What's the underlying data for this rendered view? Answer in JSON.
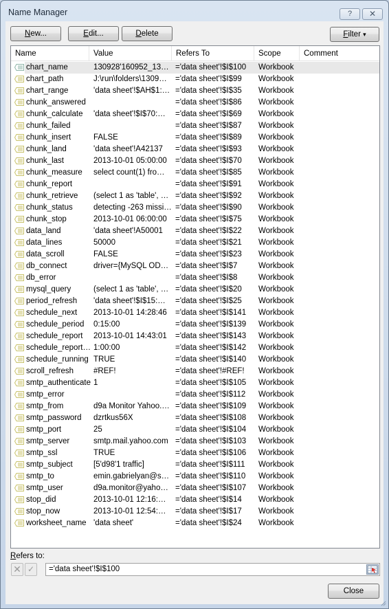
{
  "window": {
    "title": "Name Manager",
    "help_label": "?",
    "close_label": "✕"
  },
  "toolbar": {
    "new": {
      "underline": "N",
      "rest": "ew..."
    },
    "edit": {
      "underline": "E",
      "rest": "dit..."
    },
    "delete": {
      "underline": "D",
      "rest": "elete"
    },
    "filter": {
      "underline": "F",
      "rest": "ilter",
      "arrow": "▾"
    }
  },
  "list": {
    "columns": [
      "Name",
      "Value",
      "Refers To",
      "Scope",
      "Comment"
    ],
    "selected_index": 0,
    "colors": {
      "icon_selected": "#8fb5a8",
      "icon_normal": "#c8c26a",
      "selected_row": "#e8e8e8"
    },
    "rows": [
      {
        "name": "chart_name",
        "value": "130928'160952_13…",
        "refers_to": "='data sheet'!$I$100",
        "scope": "Workbook",
        "comment": ""
      },
      {
        "name": "chart_path",
        "value": "J:\\run\\folders\\1309…",
        "refers_to": "='data sheet'!$I$99",
        "scope": "Workbook",
        "comment": ""
      },
      {
        "name": "chart_range",
        "value": "'data sheet'!$AH$1:…",
        "refers_to": "='data sheet'!$I$35",
        "scope": "Workbook",
        "comment": ""
      },
      {
        "name": "chunk_answered",
        "value": "",
        "refers_to": "='data sheet'!$I$86",
        "scope": "Workbook",
        "comment": ""
      },
      {
        "name": "chunk_calculate",
        "value": "'data sheet'!$I$70:…",
        "refers_to": "='data sheet'!$I$69",
        "scope": "Workbook",
        "comment": ""
      },
      {
        "name": "chunk_failed",
        "value": "",
        "refers_to": "='data sheet'!$I$87",
        "scope": "Workbook",
        "comment": ""
      },
      {
        "name": "chunk_insert",
        "value": "FALSE",
        "refers_to": "='data sheet'!$I$89",
        "scope": "Workbook",
        "comment": ""
      },
      {
        "name": "chunk_land",
        "value": "'data sheet'!A42137",
        "refers_to": "='data sheet'!$I$93",
        "scope": "Workbook",
        "comment": ""
      },
      {
        "name": "chunk_last",
        "value": "2013-10-01 05:00:00",
        "refers_to": "='data sheet'!$I$70",
        "scope": "Workbook",
        "comment": ""
      },
      {
        "name": "chunk_measure",
        "value": "select count(1) fro…",
        "refers_to": "='data sheet'!$I$85",
        "scope": "Workbook",
        "comment": ""
      },
      {
        "name": "chunk_report",
        "value": "",
        "refers_to": "='data sheet'!$I$91",
        "scope": "Workbook",
        "comment": ""
      },
      {
        "name": "chunk_retrieve",
        "value": "(select 1 as 'table', …",
        "refers_to": "='data sheet'!$I$92",
        "scope": "Workbook",
        "comment": ""
      },
      {
        "name": "chunk_status",
        "value": "detecting -263 missi…",
        "refers_to": "='data sheet'!$I$90",
        "scope": "Workbook",
        "comment": ""
      },
      {
        "name": "chunk_stop",
        "value": "2013-10-01 06:00:00",
        "refers_to": "='data sheet'!$I$75",
        "scope": "Workbook",
        "comment": ""
      },
      {
        "name": "data_land",
        "value": "'data sheet'!A50001",
        "refers_to": "='data sheet'!$I$22",
        "scope": "Workbook",
        "comment": ""
      },
      {
        "name": "data_lines",
        "value": "50000",
        "refers_to": "='data sheet'!$I$21",
        "scope": "Workbook",
        "comment": ""
      },
      {
        "name": "data_scroll",
        "value": "FALSE",
        "refers_to": "='data sheet'!$I$23",
        "scope": "Workbook",
        "comment": ""
      },
      {
        "name": "db_connect",
        "value": "driver={MySQL OD…",
        "refers_to": "='data sheet'!$I$7",
        "scope": "Workbook",
        "comment": ""
      },
      {
        "name": "db_error",
        "value": "",
        "refers_to": "='data sheet'!$I$8",
        "scope": "Workbook",
        "comment": ""
      },
      {
        "name": "mysql_query",
        "value": "(select 1 as 'table', …",
        "refers_to": "='data sheet'!$I$20",
        "scope": "Workbook",
        "comment": ""
      },
      {
        "name": "period_refresh",
        "value": "'data sheet'!$I$15:…",
        "refers_to": "='data sheet'!$I$25",
        "scope": "Workbook",
        "comment": ""
      },
      {
        "name": "schedule_next",
        "value": "2013-10-01 14:28:46",
        "refers_to": "='data sheet'!$I$141",
        "scope": "Workbook",
        "comment": ""
      },
      {
        "name": "schedule_period",
        "value": "0:15:00",
        "refers_to": "='data sheet'!$I$139",
        "scope": "Workbook",
        "comment": ""
      },
      {
        "name": "schedule_report",
        "value": "2013-10-01 14:43:01",
        "refers_to": "='data sheet'!$I$143",
        "scope": "Workbook",
        "comment": ""
      },
      {
        "name": "schedule_report…",
        "value": "1:00:00",
        "refers_to": "='data sheet'!$I$142",
        "scope": "Workbook",
        "comment": ""
      },
      {
        "name": "schedule_running",
        "value": "TRUE",
        "refers_to": "='data sheet'!$I$140",
        "scope": "Workbook",
        "comment": ""
      },
      {
        "name": "scroll_refresh",
        "value": "#REF!",
        "refers_to": "='data sheet'!#REF!",
        "scope": "Workbook",
        "comment": ""
      },
      {
        "name": "smtp_authenticate",
        "value": "1",
        "refers_to": "='data sheet'!$I$105",
        "scope": "Workbook",
        "comment": ""
      },
      {
        "name": "smtp_error",
        "value": "",
        "refers_to": "='data sheet'!$I$112",
        "scope": "Workbook",
        "comment": ""
      },
      {
        "name": "smtp_from",
        "value": "d9a Monitor Yahoo.…",
        "refers_to": "='data sheet'!$I$109",
        "scope": "Workbook",
        "comment": ""
      },
      {
        "name": "smtp_password",
        "value": "dzrtkus56X",
        "refers_to": "='data sheet'!$I$108",
        "scope": "Workbook",
        "comment": ""
      },
      {
        "name": "smtp_port",
        "value": "25",
        "refers_to": "='data sheet'!$I$104",
        "scope": "Workbook",
        "comment": ""
      },
      {
        "name": "smtp_server",
        "value": "smtp.mail.yahoo.com",
        "refers_to": "='data sheet'!$I$103",
        "scope": "Workbook",
        "comment": ""
      },
      {
        "name": "smtp_ssl",
        "value": "TRUE",
        "refers_to": "='data sheet'!$I$106",
        "scope": "Workbook",
        "comment": ""
      },
      {
        "name": "smtp_subject",
        "value": "[5'd98'1 traffic]",
        "refers_to": "='data sheet'!$I$111",
        "scope": "Workbook",
        "comment": ""
      },
      {
        "name": "smtp_to",
        "value": "emin.gabrielyan@s…",
        "refers_to": "='data sheet'!$I$110",
        "scope": "Workbook",
        "comment": ""
      },
      {
        "name": "smtp_user",
        "value": "d9a.monitor@yaho…",
        "refers_to": "='data sheet'!$I$107",
        "scope": "Workbook",
        "comment": ""
      },
      {
        "name": "stop_did",
        "value": "2013-10-01 12:16:…",
        "refers_to": "='data sheet'!$I$14",
        "scope": "Workbook",
        "comment": ""
      },
      {
        "name": "stop_now",
        "value": "2013-10-01 12:54:…",
        "refers_to": "='data sheet'!$I$17",
        "scope": "Workbook",
        "comment": ""
      },
      {
        "name": "worksheet_name",
        "value": "'data sheet'",
        "refers_to": "='data sheet'!$I$24",
        "scope": "Workbook",
        "comment": ""
      }
    ]
  },
  "refers_to": {
    "label_underline": "R",
    "label_rest": "efers to:",
    "value": "='data sheet'!$I$100",
    "cancel_icon": "✕",
    "confirm_icon": "✓"
  },
  "footer": {
    "close_label": "Close"
  }
}
